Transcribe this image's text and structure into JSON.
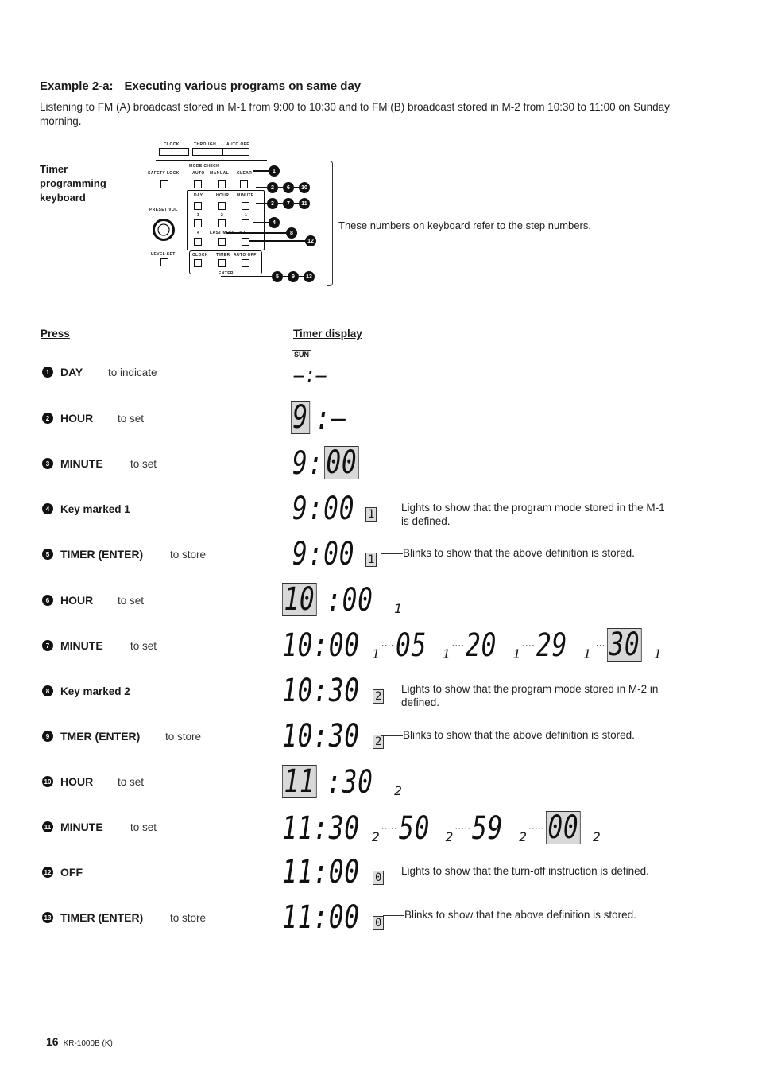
{
  "title": {
    "label": "Example 2-a:",
    "text": "Executing various programs on same day"
  },
  "intro": "Listening to FM (A) broadcast stored in M-1 from 9:00 to 10:30 and to FM (B) broadcast stored in M-2 from 10:30 to 11:00 on Sunday morning.",
  "keyboard": {
    "label": "Timer programming keyboard",
    "note": "These numbers on keyboard refer to the step numbers.",
    "top_buttons": [
      "CLOCK",
      "THROUGH",
      "AUTO OFF"
    ],
    "mode_check": "MODE CHECK",
    "labels": {
      "safety_lock": "SAFETY LOCK",
      "auto": "AUTO",
      "manual": "MANUAL",
      "clear": "CLEAR",
      "day": "DAY",
      "hour": "HOUR",
      "minute": "MINUTE",
      "key3": "3",
      "key2": "2",
      "key1": "1",
      "key4": "4",
      "last_mode_off": "LAST MODE OFF",
      "preset_vol": "PRESET VOL",
      "level_set": "LEVEL SET",
      "clock": "CLOCK",
      "timer": "TIMER",
      "auto_off": "AUTO OFF",
      "enter": "ENTER"
    },
    "callouts": [
      {
        "steps": [
          "1"
        ]
      },
      {
        "steps": [
          "2",
          "6",
          "10"
        ]
      },
      {
        "steps": [
          "3",
          "7",
          "11"
        ]
      },
      {
        "steps": [
          "4"
        ]
      },
      {
        "steps": [
          "8"
        ]
      },
      {
        "steps": [
          "12"
        ]
      },
      {
        "steps": [
          "5",
          "9",
          "13"
        ]
      }
    ]
  },
  "columns": {
    "press": "Press",
    "display": "Timer display"
  },
  "day_indicator": "SUN",
  "steps": [
    {
      "n": "1",
      "key": "DAY",
      "action": "to indicate",
      "display": "–:–",
      "note": ""
    },
    {
      "n": "2",
      "key": "HOUR",
      "action": "to set",
      "display_hl": "9",
      "display_rest": ":–",
      "note": ""
    },
    {
      "n": "3",
      "key": "MINUTE",
      "action": "to set",
      "display_pre": "9:",
      "display_hl": "00",
      "note": ""
    },
    {
      "n": "4",
      "key": "Key marked 1",
      "action": "",
      "display": "9:00",
      "mem": "1",
      "note": "Lights to show that the program mode stored in the M-1 is defined."
    },
    {
      "n": "5",
      "key": "TIMER (ENTER)",
      "action": "to store",
      "display": "9:00",
      "mem": "1",
      "note": "Blinks to show that the above definition is stored."
    },
    {
      "n": "6",
      "key": "HOUR",
      "action": "to set",
      "display_hl": "10",
      "display_rest": ":00",
      "mem": "1",
      "note": ""
    },
    {
      "n": "7",
      "key": "MINUTE",
      "action": "to set",
      "sequence": [
        "10:00",
        "05",
        "20",
        "29"
      ],
      "final": "30",
      "mem": "1",
      "note": ""
    },
    {
      "n": "8",
      "key": "Key marked 2",
      "action": "",
      "display": "10:30",
      "mem": "2",
      "note": "Lights to show that the program mode stored in M-2 in defined."
    },
    {
      "n": "9",
      "key": "TMER (ENTER)",
      "action": "to store",
      "display": "10:30",
      "mem": "2",
      "note": "Blinks to show that the above definition is stored."
    },
    {
      "n": "10",
      "key": "HOUR",
      "action": "to set",
      "display_hl": "11",
      "display_rest": ":30",
      "mem": "2",
      "note": ""
    },
    {
      "n": "11",
      "key": "MINUTE",
      "action": "to set",
      "sequence": [
        "11:30",
        "50",
        "59"
      ],
      "final": "00",
      "mem": "2",
      "note": ""
    },
    {
      "n": "12",
      "key": "OFF",
      "action": "",
      "display": "11:00",
      "mem": "0",
      "note": "Lights to show that the turn-off instruction is defined."
    },
    {
      "n": "13",
      "key": "TIMER (ENTER)",
      "action": "to store",
      "display": "11:00",
      "mem": "0",
      "note": "Blinks to show that the above definition is stored."
    }
  ],
  "footer": {
    "page": "16",
    "model": "KR-1000B (K)"
  }
}
